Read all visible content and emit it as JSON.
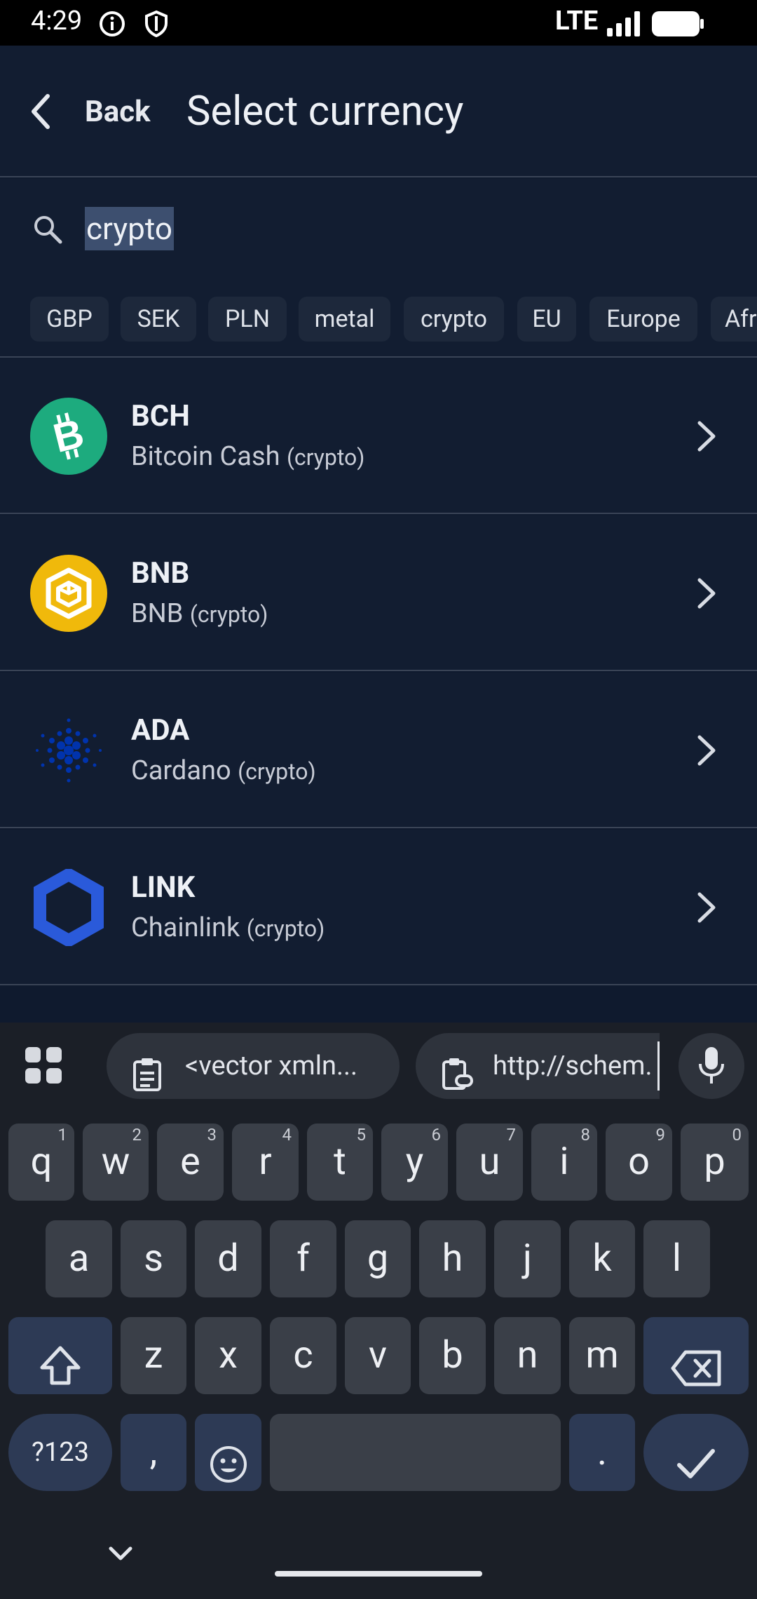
{
  "status_bar": {
    "time": "4:29",
    "network": "LTE"
  },
  "header": {
    "back_label": "Back",
    "title": "Select currency"
  },
  "search": {
    "value": "crypto",
    "placeholder": ""
  },
  "filter_chips": [
    "GBP",
    "SEK",
    "PLN",
    "metal",
    "crypto",
    "EU",
    "Europe",
    "Afr"
  ],
  "currencies": [
    {
      "code": "BCH",
      "name": "Bitcoin Cash",
      "tag": "(crypto)",
      "icon": "bitcoin-cash-icon",
      "color": "#1dab7e"
    },
    {
      "code": "BNB",
      "name": "BNB",
      "tag": "(crypto)",
      "icon": "bnb-icon",
      "color": "#f0b90b"
    },
    {
      "code": "ADA",
      "name": "Cardano",
      "tag": "(crypto)",
      "icon": "cardano-icon",
      "color": "#0033ad"
    },
    {
      "code": "LINK",
      "name": "Chainlink",
      "tag": "(crypto)",
      "icon": "chainlink-icon",
      "color": "#2a5ada"
    }
  ],
  "keyboard": {
    "clipboard": [
      "<vector xmln...",
      "http://schem."
    ],
    "row1": [
      "q",
      "w",
      "e",
      "r",
      "t",
      "y",
      "u",
      "i",
      "o",
      "p"
    ],
    "row1_nums": [
      "1",
      "2",
      "3",
      "4",
      "5",
      "6",
      "7",
      "8",
      "9",
      "0"
    ],
    "row2": [
      "a",
      "s",
      "d",
      "f",
      "g",
      "h",
      "j",
      "k",
      "l"
    ],
    "row3": [
      "z",
      "x",
      "c",
      "v",
      "b",
      "n",
      "m"
    ],
    "symbols_label": "?123",
    "comma": ",",
    "period": "."
  }
}
